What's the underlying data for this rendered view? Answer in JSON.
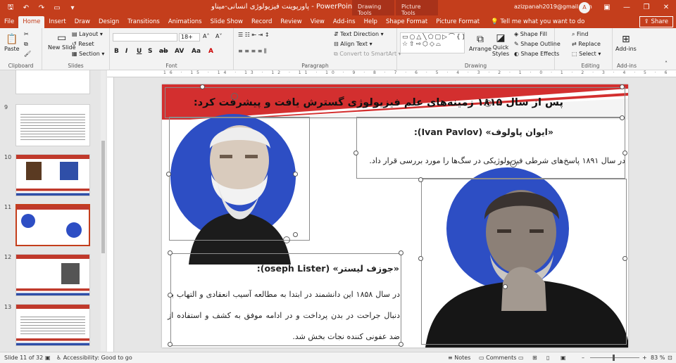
{
  "app": {
    "title": "پاورپوینت فیزیولوژی انسانی-میناو  -  PowerPoint",
    "contextual_tabs": [
      "Drawing Tools",
      "Picture Tools"
    ],
    "user_email": "azizpanah2019@gmail.com",
    "avatar_letter": "A",
    "accent_color": "#c43e1c"
  },
  "tabs": [
    "File",
    "Home",
    "Insert",
    "Draw",
    "Design",
    "Transitions",
    "Animations",
    "Slide Show",
    "Record",
    "Review",
    "View",
    "Add-ins",
    "Help",
    "Shape Format",
    "Picture Format"
  ],
  "active_tab": "Home",
  "tell_me": "Tell me what you want to do",
  "share_label": "Share",
  "ribbon": {
    "clipboard": {
      "label": "Clipboard",
      "paste": "Paste"
    },
    "slides": {
      "label": "Slides",
      "new_slide": "New Slide",
      "layout": "Layout",
      "reset": "Reset",
      "section": "Section"
    },
    "font": {
      "label": "Font",
      "size": "18+"
    },
    "paragraph": {
      "label": "Paragraph",
      "text_direction": "Text Direction",
      "align_text": "Align Text",
      "convert": "Convert to SmartArt"
    },
    "drawing": {
      "label": "Drawing",
      "arrange": "Arrange",
      "quick_styles": "Quick Styles",
      "shape_fill": "Shape Fill",
      "shape_outline": "Shape Outline",
      "shape_effects": "Shape Effects"
    },
    "editing": {
      "label": "Editing",
      "find": "Find",
      "replace": "Replace",
      "select": "Select"
    },
    "addins": {
      "label": "Add-ins",
      "btn": "Add-ins"
    }
  },
  "thumbnails": [
    {
      "num": "9"
    },
    {
      "num": "10"
    },
    {
      "num": "11"
    },
    {
      "num": "12"
    },
    {
      "num": "13"
    }
  ],
  "ruler_text": "16 · 15 · 14 · 13 · 12 · 11 · 10 · 9 · 8 · 7 · 6 · 5 · 4 · 3 · 2 · 1 · 0 · 1 · 2 · 3 · 4 · 5 · 6 · 7 · 8 · 9 · 10 · 11 · 12 · 13 · 14 · 15 · 16",
  "slide": {
    "title": "پس از سال ۱۸۱۵ زمینه‌های علم فیزیولوژی گسترش یافت و پیشرفت کرد:",
    "pavlov_heading": "«ایوان پاولوف» (Ivan Pavlov):",
    "pavlov_body": "در سال ۱۸۹۱ پاسخ‌های شرطی فیزیولوژیکی در سگ‌ها را مورد بررسی قرار داد.",
    "lister_heading": "«جوزف لیستر» (oseph Lister):",
    "lister_body": "در سال ۱۸۵۸ این دانشمند در ابتدا به مطالعه آسیب انعقادی و التهاب به دنبال جراحت در بدن پرداخت و در ادامه موفق به کشف و استفاده از ضد عفونی کننده نجات بخش شد."
  },
  "status": {
    "slide_info": "Slide 11 of 32",
    "accessibility": "Accessibility: Good to go",
    "notes": "Notes",
    "comments": "Comments",
    "zoom": "83 %"
  }
}
